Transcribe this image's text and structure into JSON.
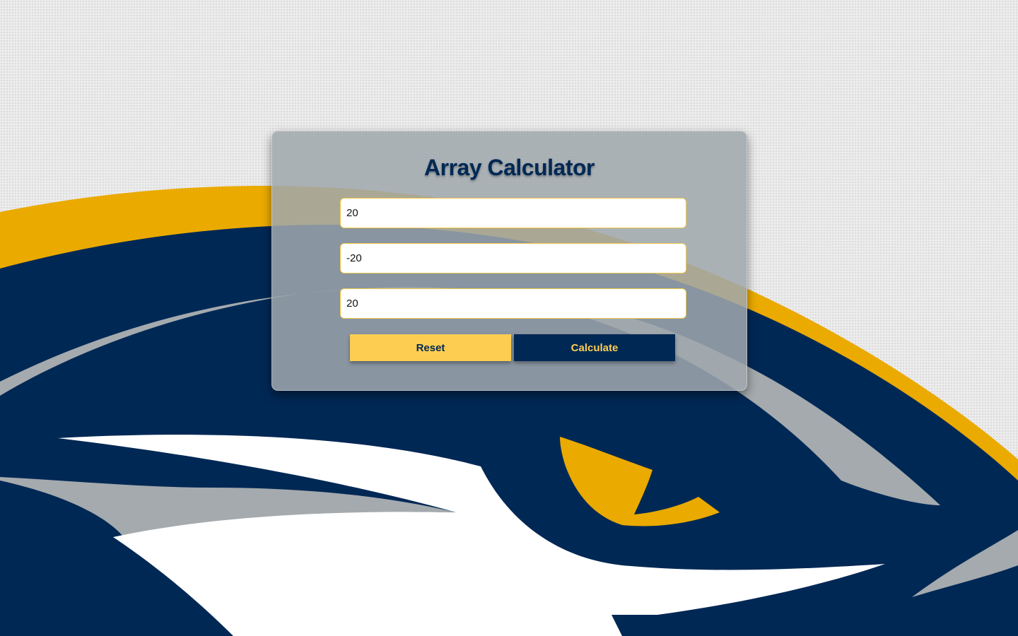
{
  "app": {
    "title": "Array Calculator"
  },
  "form": {
    "inputs": [
      {
        "value": "20"
      },
      {
        "value": "-20"
      },
      {
        "value": "20"
      }
    ],
    "reset_label": "Reset",
    "calculate_label": "Calculate"
  },
  "colors": {
    "navy": "#002855",
    "gold": "#eaaa00",
    "light_gold": "#fdcd52",
    "silver": "#a4aaad",
    "white": "#ffffff"
  },
  "background": {
    "logo_icon": "eagle-logo-icon"
  }
}
